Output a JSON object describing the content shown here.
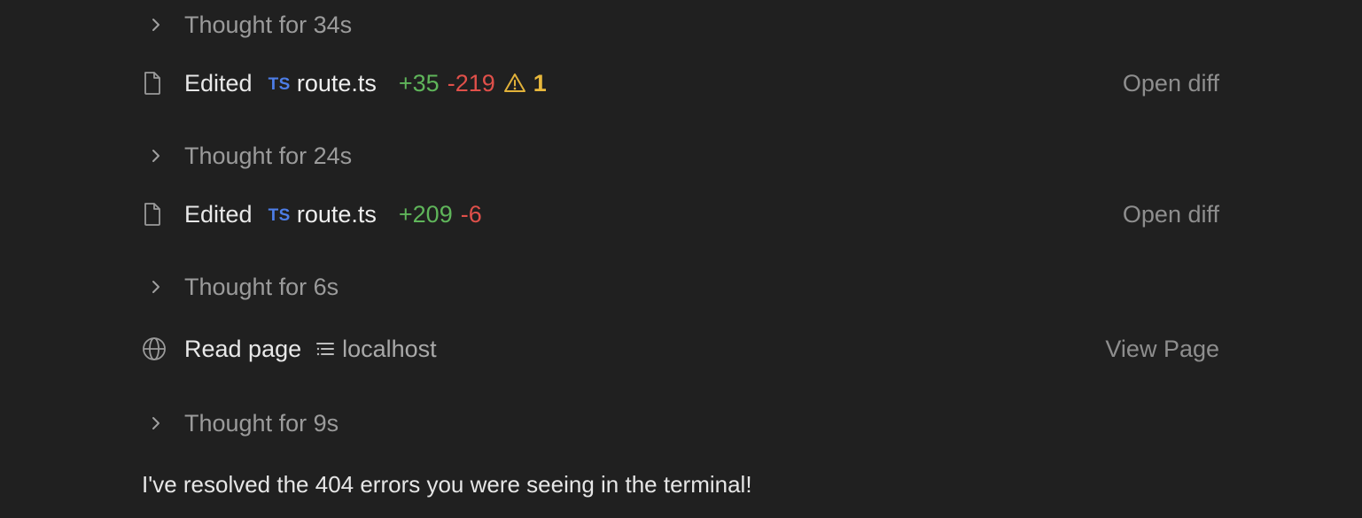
{
  "entries": [
    {
      "type": "thought",
      "label": "Thought for 34s",
      "icon": "chevron-right-icon"
    },
    {
      "type": "edit",
      "icon": "file-icon",
      "action": "Edited",
      "lang_badge": "TS",
      "file": "route.ts",
      "added": "+35",
      "removed": "-219",
      "warning_icon": "warning-triangle-icon",
      "warning_count": "1",
      "link": "Open diff"
    },
    {
      "type": "thought",
      "label": "Thought for 24s",
      "icon": "chevron-right-icon"
    },
    {
      "type": "edit",
      "icon": "file-icon",
      "action": "Edited",
      "lang_badge": "TS",
      "file": "route.ts",
      "added": "+209",
      "removed": "-6",
      "link": "Open diff"
    },
    {
      "type": "thought",
      "label": "Thought for 6s",
      "icon": "chevron-right-icon"
    },
    {
      "type": "read",
      "icon": "globe-icon",
      "action": "Read page",
      "source_icon": "list-indent-icon",
      "source": "localhost",
      "link": "View Page"
    },
    {
      "type": "thought",
      "label": "Thought for 9s",
      "icon": "chevron-right-icon"
    }
  ],
  "message": "I've resolved the 404 errors you were seeing in the terminal!",
  "colors": {
    "background": "#202020",
    "added": "#5fb55a",
    "removed": "#e0504a",
    "warning": "#e2b23a",
    "ts_badge": "#4d7de6",
    "muted": "#9b9b9b"
  }
}
